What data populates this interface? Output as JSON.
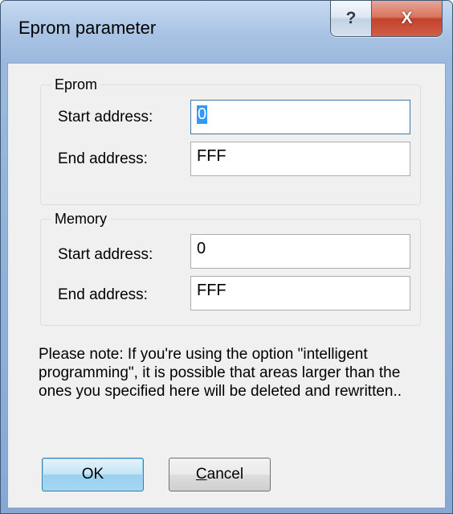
{
  "window": {
    "title": "Eprom parameter"
  },
  "caption_buttons": {
    "help_glyph": "?",
    "close_glyph": "X"
  },
  "eprom": {
    "label": "Eprom",
    "start_label": "Start address:",
    "start_value": "0",
    "end_label": "End address:",
    "end_value": "FFF"
  },
  "memory": {
    "label": "Memory",
    "start_label": "Start address:",
    "start_value": "0",
    "end_label": "End address:",
    "end_value": "FFF"
  },
  "note": "Please note: If you're using the option \"intelligent programming\", it is possible that areas larger than the ones you specified here will be deleted and rewritten..",
  "buttons": {
    "ok": "OK",
    "cancel_mnemonic": "C",
    "cancel_rest": "ancel"
  },
  "colors": {
    "accent": "#3c7fb1",
    "close": "#c4412b",
    "dialog_bg": "#f0f0f0"
  }
}
